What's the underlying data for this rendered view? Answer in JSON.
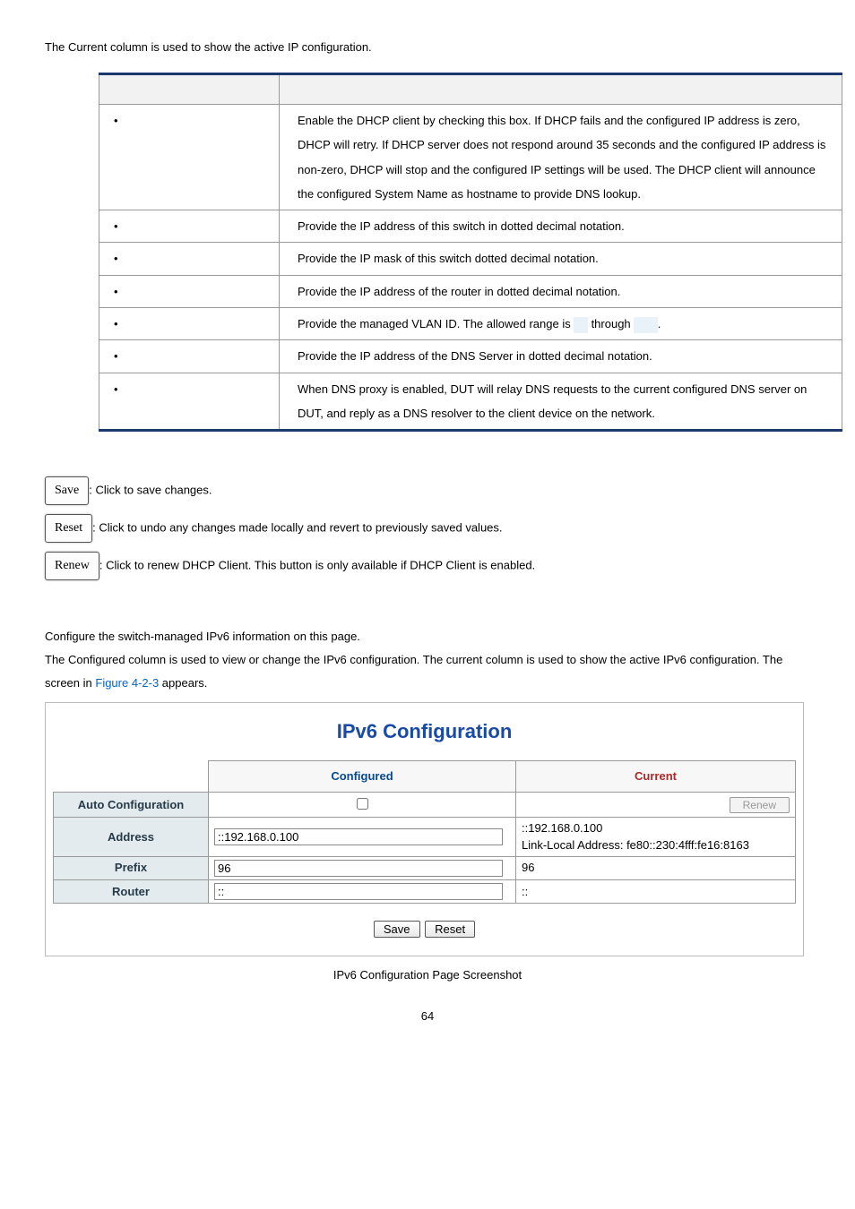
{
  "intro": "The Current column is used to show the active IP configuration.",
  "rows": {
    "r1": "Enable the DHCP client by checking this box. If DHCP fails and the configured IP address is zero, DHCP will retry. If DHCP server does not respond around 35 seconds and the configured IP address is non-zero, DHCP will stop and the configured IP settings will be used. The DHCP client will announce the configured System Name as hostname to provide DNS lookup.",
    "r2": "Provide the IP address of this switch in dotted decimal notation.",
    "r3": "Provide the IP mask of this switch dotted decimal notation.",
    "r4": "Provide the IP address of the router in dotted decimal notation.",
    "r5a": "Provide the managed VLAN ID. The allowed range is ",
    "r5b": " through ",
    "r5c": ".",
    "r6": "Provide the IP address of the DNS Server in dotted decimal notation.",
    "r7": "When DNS proxy is enabled, DUT will relay DNS requests to the current configured DNS server on DUT, and reply as a DNS resolver to the client device on the network."
  },
  "buttons": {
    "save": "Save",
    "save_desc": ": Click to save changes.",
    "reset": "Reset",
    "reset_desc": ": Click to undo any changes made locally and revert to previously saved values.",
    "renew": "Renew",
    "renew_desc": ": Click to renew DHCP Client. This button is only available if DHCP Client is enabled."
  },
  "sect2": {
    "p1": "Configure the switch-managed IPv6 information on this page.",
    "p2a": "The Configured column is used to view or change the IPv6 configuration. The current column is used to show the active IPv6 configuration. The screen in ",
    "link": "Figure 4-2-3",
    "p2b": " appears."
  },
  "ipv6": {
    "title": "IPv6 Configuration",
    "hdr_cfg": "Configured",
    "hdr_cur": "Current",
    "row_auto": "Auto Configuration",
    "renew_btn": "Renew",
    "row_addr": "Address",
    "addr_val": "::192.168.0.100",
    "addr_cur1": "::192.168.0.100",
    "addr_cur2": "Link-Local Address: fe80::230:4fff:fe16:8163",
    "row_prefix": "Prefix",
    "prefix_val": "96",
    "prefix_cur": "96",
    "row_router": "Router",
    "router_val": "::",
    "router_cur": "::",
    "btn_save": "Save",
    "btn_reset": "Reset",
    "caption": "IPv6 Configuration Page Screenshot"
  },
  "page": "64"
}
